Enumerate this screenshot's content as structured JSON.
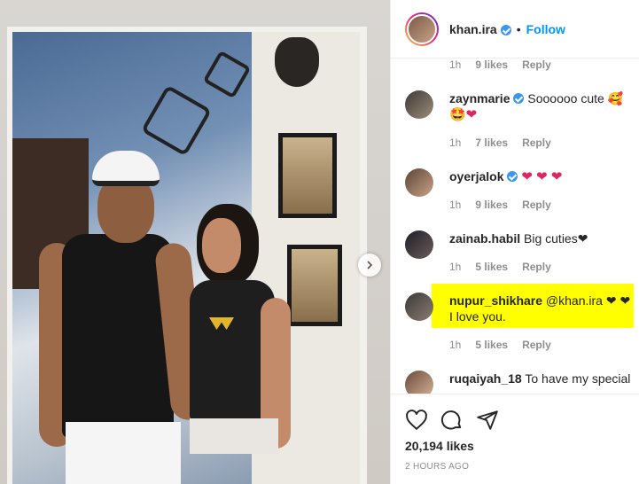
{
  "post": {
    "author": "khan.ira",
    "follow_label": "Follow",
    "separator": "•"
  },
  "comments": [
    {
      "meta_time": "1h",
      "meta_likes": "9 likes",
      "meta_reply": "Reply"
    },
    {
      "user": "zaynmarie",
      "verified": true,
      "text": "Soooooo cute 🥰",
      "text2": "🤩❤",
      "time": "1h",
      "likes": "7 likes",
      "reply": "Reply"
    },
    {
      "user": "oyerjalok",
      "verified": true,
      "text": "❤ ❤ ❤",
      "time": "1h",
      "likes": "9 likes",
      "reply": "Reply"
    },
    {
      "user": "zainab.habil",
      "text": "Big cuties❤",
      "time": "1h",
      "likes": "5 likes",
      "reply": "Reply"
    },
    {
      "user": "nupur_shikhare",
      "text": "@khan.ira ❤ ❤",
      "text2": "I love you.",
      "time": "1h",
      "likes": "5 likes",
      "reply": "Reply",
      "highlight_color": "#ffff00"
    },
    {
      "user": "ruqaiyah_18",
      "text": "To have my special"
    }
  ],
  "actions": {
    "like_icon": "heart-outline-icon",
    "comment_icon": "comment-icon",
    "share_icon": "paper-plane-icon",
    "likes": "20,194 likes",
    "timestamp": "2 HOURS AGO"
  },
  "colors": {
    "accent": "#0095f6",
    "verified": "#3897f0",
    "heart": "#e0245e",
    "highlight": "#ffff00"
  }
}
